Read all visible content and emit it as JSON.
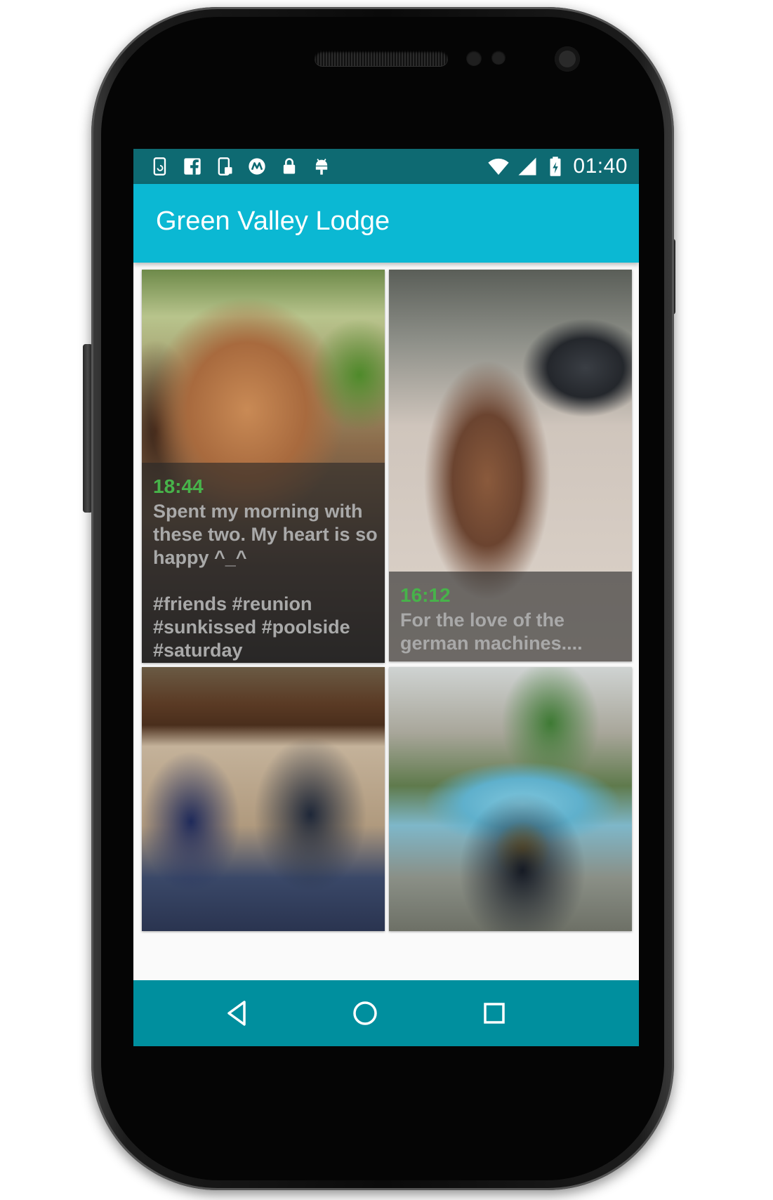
{
  "status_bar": {
    "time": "01:40",
    "notification_icons": [
      "phone-sync-icon",
      "facebook-icon",
      "phone-lock-icon",
      "motorola-icon",
      "lock-icon",
      "android-icon"
    ],
    "system_icons": [
      "wifi-icon",
      "cellular-signal-icon",
      "battery-charging-icon"
    ]
  },
  "app_bar": {
    "title": "Green Valley Lodge"
  },
  "posts": [
    {
      "time": "18:44",
      "caption": "Spent my morning with these two. My heart is so happy ^_^\n\n#friends #reunion #sunkissed #poolside #saturday"
    },
    {
      "time": "16:12",
      "caption": "For the love of the german machines...."
    },
    {
      "time": "",
      "caption": ""
    },
    {
      "time": "",
      "caption": ""
    }
  ],
  "nav_bar": {
    "buttons": [
      "back-icon",
      "home-icon",
      "recents-icon"
    ]
  },
  "colors": {
    "status_bar": "#0e6a72",
    "app_bar": "#0bb8d3",
    "nav_bar": "#008f9e",
    "time_accent": "#47b34a",
    "caption_text": "#a9a9a9"
  }
}
